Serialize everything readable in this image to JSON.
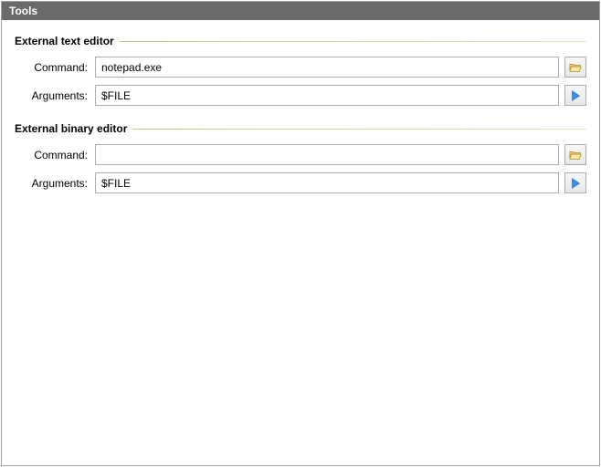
{
  "titlebar": {
    "text": "Tools"
  },
  "groups": {
    "text_editor": {
      "title": "External text editor",
      "command_label": "Command:",
      "command_value": "notepad.exe",
      "arguments_label": "Arguments:",
      "arguments_value": "$FILE"
    },
    "binary_editor": {
      "title": "External binary editor",
      "command_label": "Command:",
      "command_value": "",
      "arguments_label": "Arguments:",
      "arguments_value": "$FILE"
    }
  }
}
